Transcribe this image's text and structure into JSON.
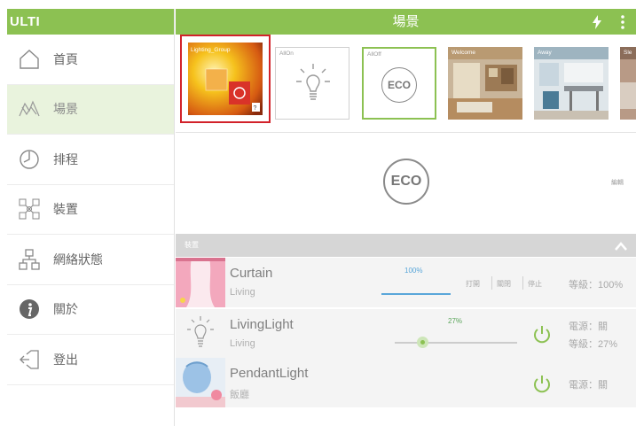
{
  "app": {
    "title": "ULTI"
  },
  "header": {
    "title": "場景"
  },
  "sidebar": {
    "items": [
      {
        "label": "首頁",
        "icon": "home-icon"
      },
      {
        "label": "場景",
        "icon": "scene-icon",
        "active": true
      },
      {
        "label": "排程",
        "icon": "clock-icon"
      },
      {
        "label": "裝置",
        "icon": "devices-icon"
      },
      {
        "label": "網絡狀態",
        "icon": "network-icon"
      },
      {
        "label": "關於",
        "icon": "info-icon"
      },
      {
        "label": "登出",
        "icon": "logout-icon"
      }
    ]
  },
  "scenes": [
    {
      "caption": "Lighting_Group",
      "selected": true,
      "badge": "?"
    },
    {
      "caption": "AllOn",
      "icon": "bulb-icon"
    },
    {
      "caption": "AllOff",
      "icon": "eco-icon",
      "icon_text": "ECO"
    },
    {
      "caption": "Welcome"
    },
    {
      "caption": "Away"
    },
    {
      "caption": "Sle"
    }
  ],
  "current_scene": {
    "icon_text": "ECO",
    "edit_label": "編輯"
  },
  "devices": {
    "title": "裝置",
    "rows": [
      {
        "name": "Curtain",
        "room": "Living",
        "percent": "100%",
        "level": 1.0,
        "buttons": [
          "打開",
          "關閉",
          "停止"
        ],
        "level_label": "等級：100%"
      },
      {
        "name": "LivingLight",
        "room": "Living",
        "percent": "27%",
        "level": 0.27,
        "power_label": "電源：關",
        "level_label": "等級：27%"
      },
      {
        "name": "PendantLight",
        "room": "飯廳",
        "power_label": "電源：關"
      }
    ]
  },
  "colors": {
    "accent": "#8cc152",
    "selected": "#d2222a",
    "curtain_blue": "#59a6d9"
  }
}
